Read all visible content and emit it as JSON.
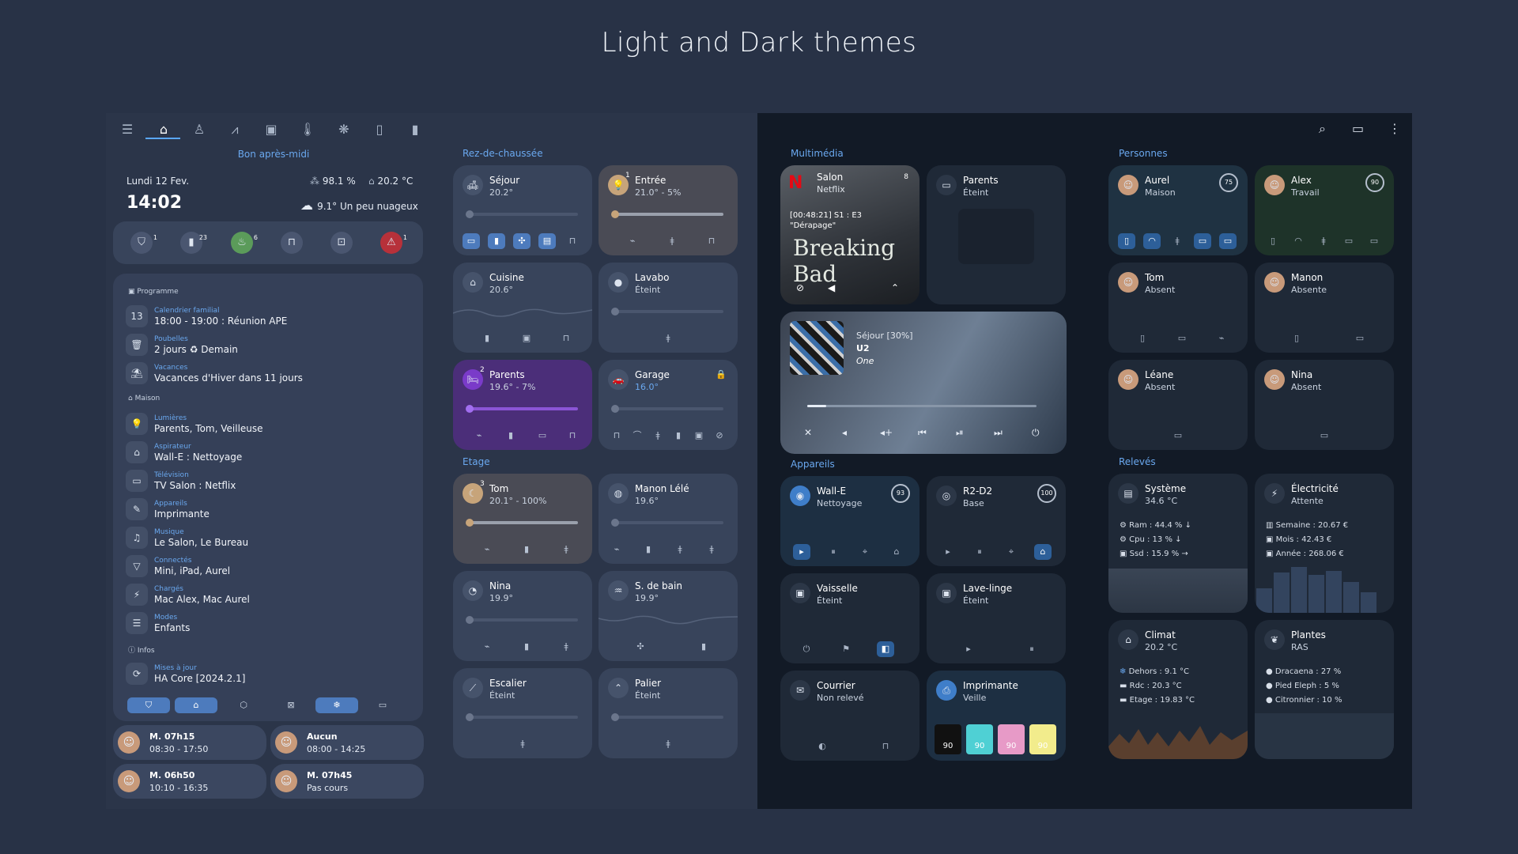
{
  "page_title": "Light and Dark themes",
  "light": {
    "greeting": "Bon après-midi",
    "date": "Lundi 12 Fev.",
    "time": "14:02",
    "humidity": "98.1 %",
    "indoor_temp": "20.2 °C",
    "weather": "9.1° Un peu nuageux",
    "pills": [
      {
        "icon": "shield-icon",
        "glyph": "⛉",
        "badge": "1"
      },
      {
        "icon": "battery-icon",
        "glyph": "▮",
        "badge": "23"
      },
      {
        "icon": "radiator-icon",
        "glyph": "♨",
        "badge": "6"
      },
      {
        "icon": "door-icon",
        "glyph": "⊓",
        "badge": ""
      },
      {
        "icon": "lock-icon",
        "glyph": "🔒",
        "badge": ""
      },
      {
        "icon": "alert-icon",
        "glyph": "⚠",
        "badge": "1"
      }
    ],
    "programme_header": "Programme",
    "programme": [
      {
        "label": "Calendrier familial",
        "value": "18:00 - 19:00 : Réunion APE",
        "glyph": "13"
      },
      {
        "label": "Poubelles",
        "value": "2 jours ♻ Demain",
        "glyph": "🗑"
      },
      {
        "label": "Vacances",
        "value": "Vacances d'Hiver dans 11 jours",
        "glyph": "⛱"
      }
    ],
    "maison_header": "Maison",
    "maison": [
      {
        "label": "Lumières",
        "value": "Parents, Tom, Veilleuse",
        "glyph": "💡"
      },
      {
        "label": "Aspirateur",
        "value": "Wall-E : Nettoyage",
        "glyph": "⌂"
      },
      {
        "label": "Télévision",
        "value": "TV Salon : Netflix",
        "glyph": "▭"
      },
      {
        "label": "Appareils",
        "value": "Imprimante",
        "glyph": "✎"
      },
      {
        "label": "Musique",
        "value": "Le Salon, Le Bureau",
        "glyph": "♫"
      },
      {
        "label": "Connectés",
        "value": "Mini, iPad, Aurel",
        "glyph": "▽"
      },
      {
        "label": "Chargés",
        "value": "Mac Alex, Mac Aurel",
        "glyph": "⚡"
      },
      {
        "label": "Modes",
        "value": "Enfants",
        "glyph": "☰"
      }
    ],
    "infos_header": "Infos",
    "infos": [
      {
        "label": "Mises à jour",
        "value": "HA Core [2024.2.1]",
        "glyph": "⟳"
      }
    ],
    "prog_tabs": [
      "⛉",
      "⌂",
      "⬡",
      "⊠",
      "❄",
      "▭"
    ],
    "alarms": [
      {
        "title": "M. 07h15",
        "sub": "08:30 - 17:50"
      },
      {
        "title": "Aucun",
        "sub": "08:00 - 14:25"
      },
      {
        "title": "M. 06h50",
        "sub": "10:10 - 16:35"
      },
      {
        "title": "M. 07h45",
        "sub": "Pas cours"
      }
    ],
    "rdc_header": "Rez-de-chaussée",
    "etage_header": "Etage",
    "rooms": [
      {
        "name": "Séjour",
        "state": "20.2°",
        "glyph": "🛋"
      },
      {
        "name": "Entrée",
        "state": "21.0° - 5%",
        "glyph": "💡",
        "badge": "1"
      },
      {
        "name": "Cuisine",
        "state": "20.6°",
        "glyph": "⌂"
      },
      {
        "name": "Lavabo",
        "state": "Éteint",
        "glyph": "●"
      },
      {
        "name": "Parents",
        "state": "19.6° - 7%",
        "glyph": "🛏",
        "badge": "2"
      },
      {
        "name": "Garage",
        "state": "16.0°",
        "glyph": "🚗"
      },
      {
        "name": "Tom",
        "state": "20.1° - 100%",
        "glyph": "☾",
        "badge": "3"
      },
      {
        "name": "Manon Lélé",
        "state": "19.6°",
        "glyph": "◍"
      },
      {
        "name": "Nina",
        "state": "19.9°",
        "glyph": "◔"
      },
      {
        "name": "S. de bain",
        "state": "19.9°",
        "glyph": "♒"
      },
      {
        "name": "Escalier",
        "state": "Éteint",
        "glyph": "⟋"
      },
      {
        "name": "Palier",
        "state": "Éteint",
        "glyph": "⌃"
      }
    ]
  },
  "dark": {
    "multimedia_header": "Multimédia",
    "salon": {
      "name": "Salon",
      "app": "Netflix",
      "episode": "[00:48:21] S1 : E3",
      "title": "\"Dérapage\"",
      "show": "Breaking Bad",
      "badge": "8"
    },
    "parents_tv": {
      "name": "Parents",
      "state": "Éteint"
    },
    "music": {
      "room": "Séjour [30%]",
      "artist": "U2",
      "track": "One"
    },
    "appareils_header": "Appareils",
    "appareils": [
      {
        "name": "Wall-E",
        "state": "Nettoyage",
        "ring": "93"
      },
      {
        "name": "R2-D2",
        "state": "Base",
        "ring": "100"
      },
      {
        "name": "Vaisselle",
        "state": "Éteint"
      },
      {
        "name": "Lave-linge",
        "state": "Éteint"
      },
      {
        "name": "Courrier",
        "state": "Non relevé"
      },
      {
        "name": "Imprimante",
        "state": "Veille"
      }
    ],
    "ink": [
      "90",
      "90",
      "90",
      "90"
    ],
    "personnes_header": "Personnes",
    "persons": [
      {
        "name": "Aurel",
        "state": "Maison",
        "ring": "75"
      },
      {
        "name": "Alex",
        "state": "Travail",
        "ring": "90"
      },
      {
        "name": "Tom",
        "state": "Absent"
      },
      {
        "name": "Manon",
        "state": "Absente"
      },
      {
        "name": "Léane",
        "state": "Absent"
      },
      {
        "name": "Nina",
        "state": "Absent"
      }
    ],
    "releves_header": "Relevés",
    "systeme": {
      "name": "Système",
      "state": "34.6 °C",
      "lines": [
        "Ram : 44.4 % ↓",
        "Cpu : 13 % ↓",
        "Ssd : 15.9 % →"
      ]
    },
    "electricite": {
      "name": "Électricité",
      "state": "Attente",
      "lines": [
        "Semaine : 20.67 €",
        "Mois : 42.43 €",
        "Année : 268.06 €"
      ]
    },
    "climat": {
      "name": "Climat",
      "state": "20.2 °C",
      "lines": [
        "Dehors : 9.1 °C",
        "Rdc : 20.3 °C",
        "Etage : 19.83 °C"
      ]
    },
    "plantes": {
      "name": "Plantes",
      "state": "RAS",
      "lines": [
        "Dracaena : 27 %",
        "Pied Eleph : 5 %",
        "Citronnier : 10 %"
      ]
    }
  },
  "colors": {
    "accent": "#5aa7ff",
    "light_bg": "#2b3549",
    "dark_bg": "#121a26"
  }
}
